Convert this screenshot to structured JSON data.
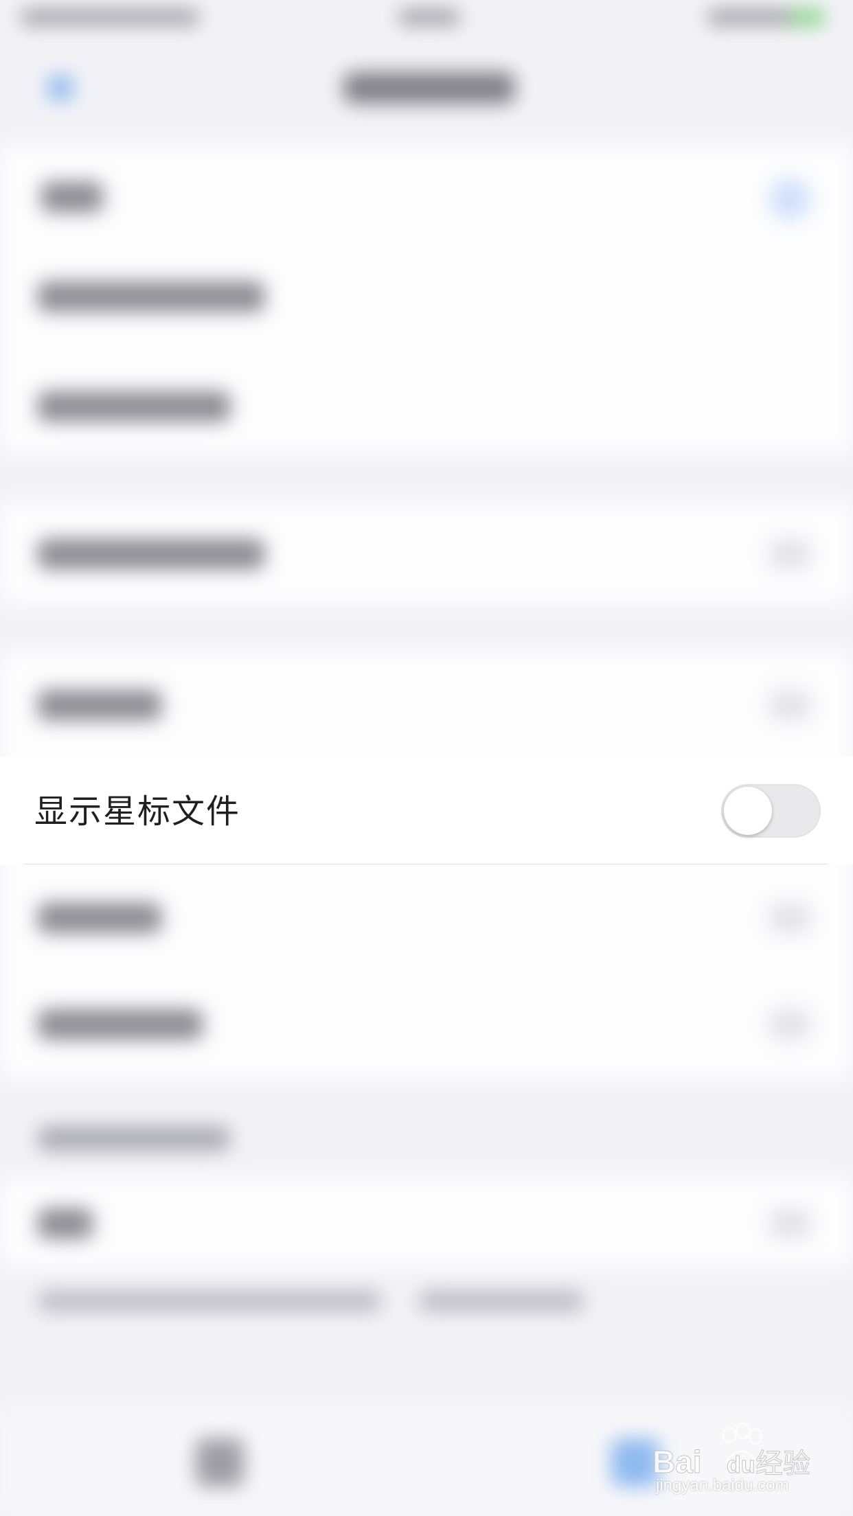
{
  "setting_row": {
    "label": "显示星标文件",
    "toggle_on": false
  },
  "watermark": {
    "brand": "Bai",
    "brand_tail": "du",
    "product": "经验",
    "url": "jingyan.baidu.com"
  },
  "colors": {
    "background": "#f3f3f7",
    "row_background": "#ffffff",
    "toggle_off_track": "#e9e9ec",
    "text": "#1f1f1f"
  }
}
